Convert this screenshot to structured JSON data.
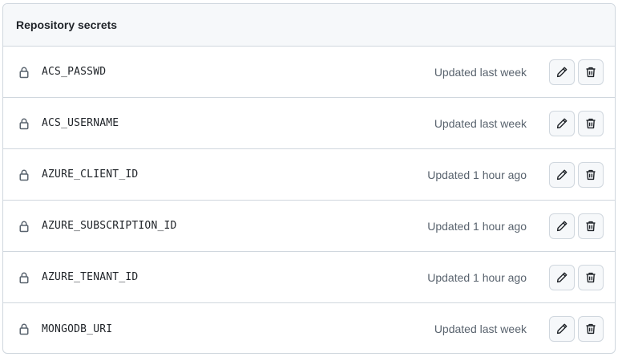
{
  "panel": {
    "title": "Repository secrets"
  },
  "secrets": [
    {
      "name": "ACS_PASSWD",
      "updated": "Updated last week"
    },
    {
      "name": "ACS_USERNAME",
      "updated": "Updated last week"
    },
    {
      "name": "AZURE_CLIENT_ID",
      "updated": "Updated 1 hour ago"
    },
    {
      "name": "AZURE_SUBSCRIPTION_ID",
      "updated": "Updated 1 hour ago"
    },
    {
      "name": "AZURE_TENANT_ID",
      "updated": "Updated 1 hour ago"
    },
    {
      "name": "MONGODB_URI",
      "updated": "Updated last week"
    }
  ],
  "icons": {
    "row": "lock-icon",
    "edit": "pencil-icon",
    "delete": "trash-icon"
  },
  "colors": {
    "border": "#d0d7de",
    "header_bg": "#f6f8fa",
    "muted_text": "#59636e",
    "text": "#1f2328"
  }
}
